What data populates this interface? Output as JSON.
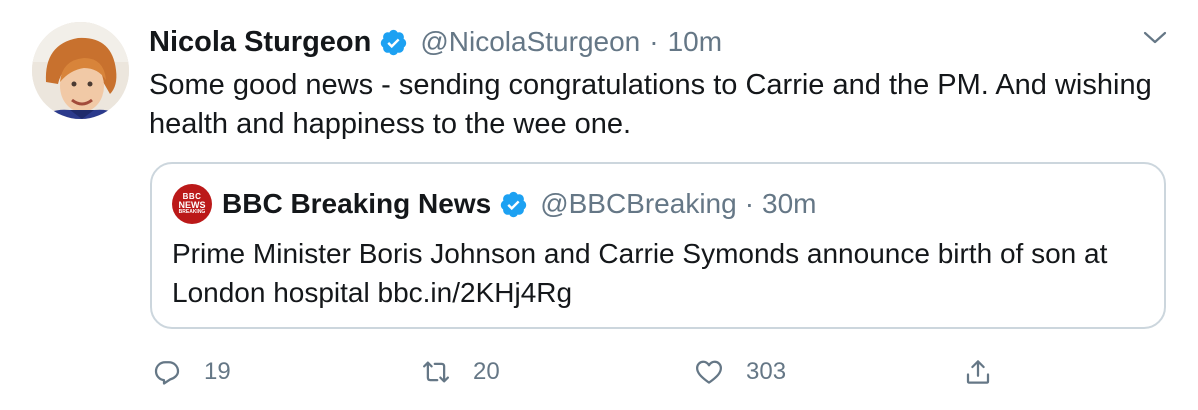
{
  "tweet": {
    "author_name": "Nicola Sturgeon",
    "author_handle": "@NicolaSturgeon",
    "separator": "·",
    "time": "10m",
    "text": "Some good news - sending congratulations to Carrie and the PM. And wishing health and happiness to the wee one."
  },
  "quoted_tweet": {
    "avatar_lines": [
      "BBC",
      "NEWS",
      "BREAKING"
    ],
    "author_name": "BBC Breaking News",
    "author_handle": "@BBCBreaking",
    "separator": "·",
    "time": "30m",
    "text": "Prime Minister Boris Johnson and Carrie Symonds announce birth of son at London hospital bbc.in/2KHj4Rg"
  },
  "actions": {
    "reply_count": "19",
    "retweet_count": "20",
    "like_count": "303"
  },
  "colors": {
    "verified_blue": "#1da1f2",
    "secondary_text": "#657786",
    "border": "#ccd6dd",
    "bbc_red": "#bb1919"
  },
  "icons": {
    "verified": "verified-badge-icon",
    "caret": "chevron-down-icon",
    "reply": "reply-icon",
    "retweet": "retweet-icon",
    "like": "heart-icon",
    "share": "share-icon"
  }
}
